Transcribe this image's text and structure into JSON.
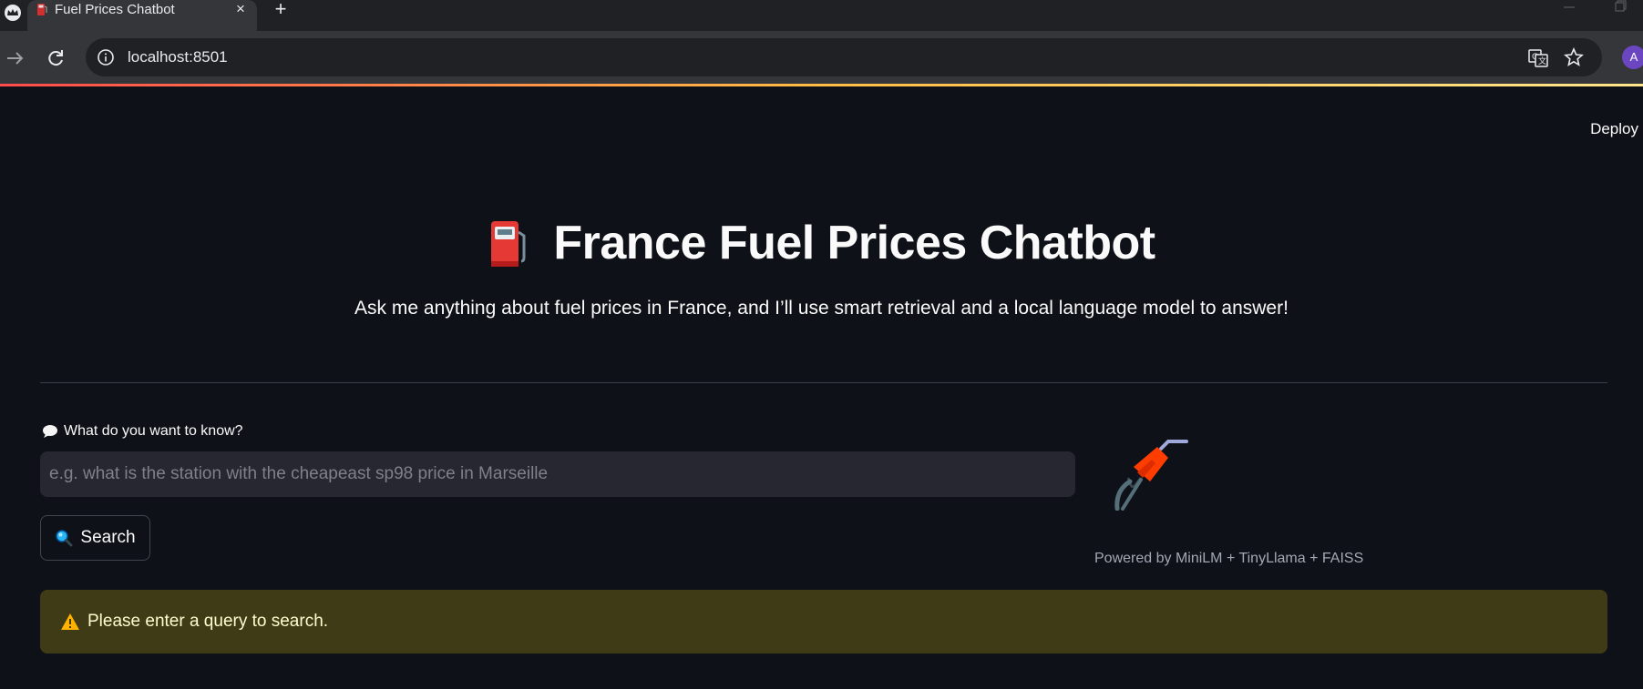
{
  "browser": {
    "tab_title": "Fuel Prices Chatbot",
    "tab_close": "×",
    "new_tab": "+",
    "url": "localhost:8501",
    "profile_initial": "A"
  },
  "app": {
    "deploy_label": "Deploy",
    "title": "France Fuel Prices Chatbot",
    "title_icon": "fuel-pump-icon",
    "subtitle": "Ask me anything about fuel prices in France, and I’ll use smart retrieval and a local language model to answer!",
    "query_label": "What do you want to know?",
    "query_label_icon": "speech-bubble-icon",
    "query_placeholder": "e.g. what is the station with the cheapeast sp98 price in Marseille",
    "query_value": "",
    "search_label": "Search",
    "search_icon": "magnifier-icon",
    "side_image_icon": "fuel-nozzle-icon",
    "powered_by": "Powered by MiniLM + TinyLlama + FAISS",
    "warning_message": "Please enter a query to search.",
    "warning_icon": "warning-icon"
  },
  "colors": {
    "background": "#0e1117",
    "input_background": "#262730",
    "warning_background": "#3e3b16",
    "warning_text": "#fffbce",
    "accent_gradient": [
      "#ff4b4b",
      "#ffbd45",
      "#ffe68a"
    ]
  }
}
